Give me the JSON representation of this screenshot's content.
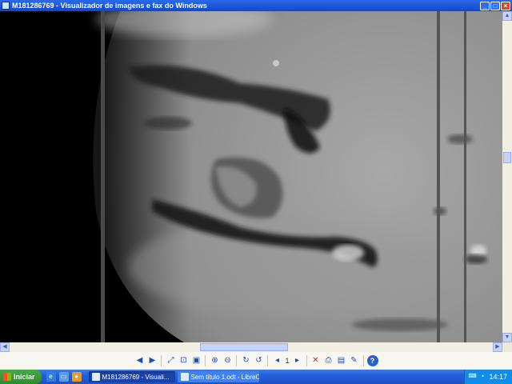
{
  "window": {
    "title": "M181286769 - Visualizador de imagens e fax do Windows",
    "icon": "image-viewer-icon",
    "controls": [
      "minimize-icon",
      "maximize-icon",
      "close-icon"
    ]
  },
  "viewer": {
    "image_subject": "grayscale lunar surface photograph with two vertical scan lines",
    "colors": {
      "surface_light": "#b8b8b8",
      "surface_mid": "#8a8a8a",
      "shadow": "#111111"
    }
  },
  "toolbar": {
    "buttons": [
      {
        "name": "previous-image-button",
        "icon": "previous-icon",
        "glyph": "◀"
      },
      {
        "name": "next-image-button",
        "icon": "next-icon",
        "glyph": "▶"
      },
      {
        "name": "best-fit-button",
        "icon": "best-fit-icon",
        "glyph": "⤢"
      },
      {
        "name": "actual-size-button",
        "icon": "actual-size-icon",
        "glyph": "⊡"
      },
      {
        "name": "slideshow-button",
        "icon": "slideshow-icon",
        "glyph": "▣"
      },
      {
        "name": "zoom-in-button",
        "icon": "zoom-in-icon",
        "glyph": "⊕"
      },
      {
        "name": "zoom-out-button",
        "icon": "zoom-out-icon",
        "glyph": "⊖"
      },
      {
        "name": "rotate-clockwise-button",
        "icon": "rotate-clockwise-icon",
        "glyph": "↻"
      },
      {
        "name": "rotate-counterclockwise-button",
        "icon": "rotate-counterclockwise-icon",
        "glyph": "↺"
      }
    ],
    "page_prev_glyph": "◂",
    "page_number": "1",
    "page_next_glyph": "▸",
    "buttons2": [
      {
        "name": "delete-button",
        "icon": "delete-icon",
        "glyph": "✕",
        "red": true
      },
      {
        "name": "print-button",
        "icon": "print-icon",
        "glyph": "⎙"
      },
      {
        "name": "save-button",
        "icon": "save-icon",
        "glyph": "▤"
      },
      {
        "name": "edit-button",
        "icon": "edit-icon",
        "glyph": "✎"
      },
      {
        "name": "help-button",
        "icon": "help-icon",
        "glyph": "?",
        "help": true
      }
    ]
  },
  "taskbar": {
    "start_label": "Iniciar",
    "quick_launch": [
      "ie-icon",
      "desktop-icon",
      "media-icon"
    ],
    "tasks": [
      {
        "label": "M181286769 - Visuali...",
        "active": true,
        "icon": "image-viewer-icon"
      },
      {
        "label": "Sem título 1.odt - LibreO...",
        "active": false,
        "icon": "writer-icon"
      }
    ],
    "tray_icons": [
      "language-icon",
      "network-icon"
    ],
    "clock": "14:17"
  }
}
